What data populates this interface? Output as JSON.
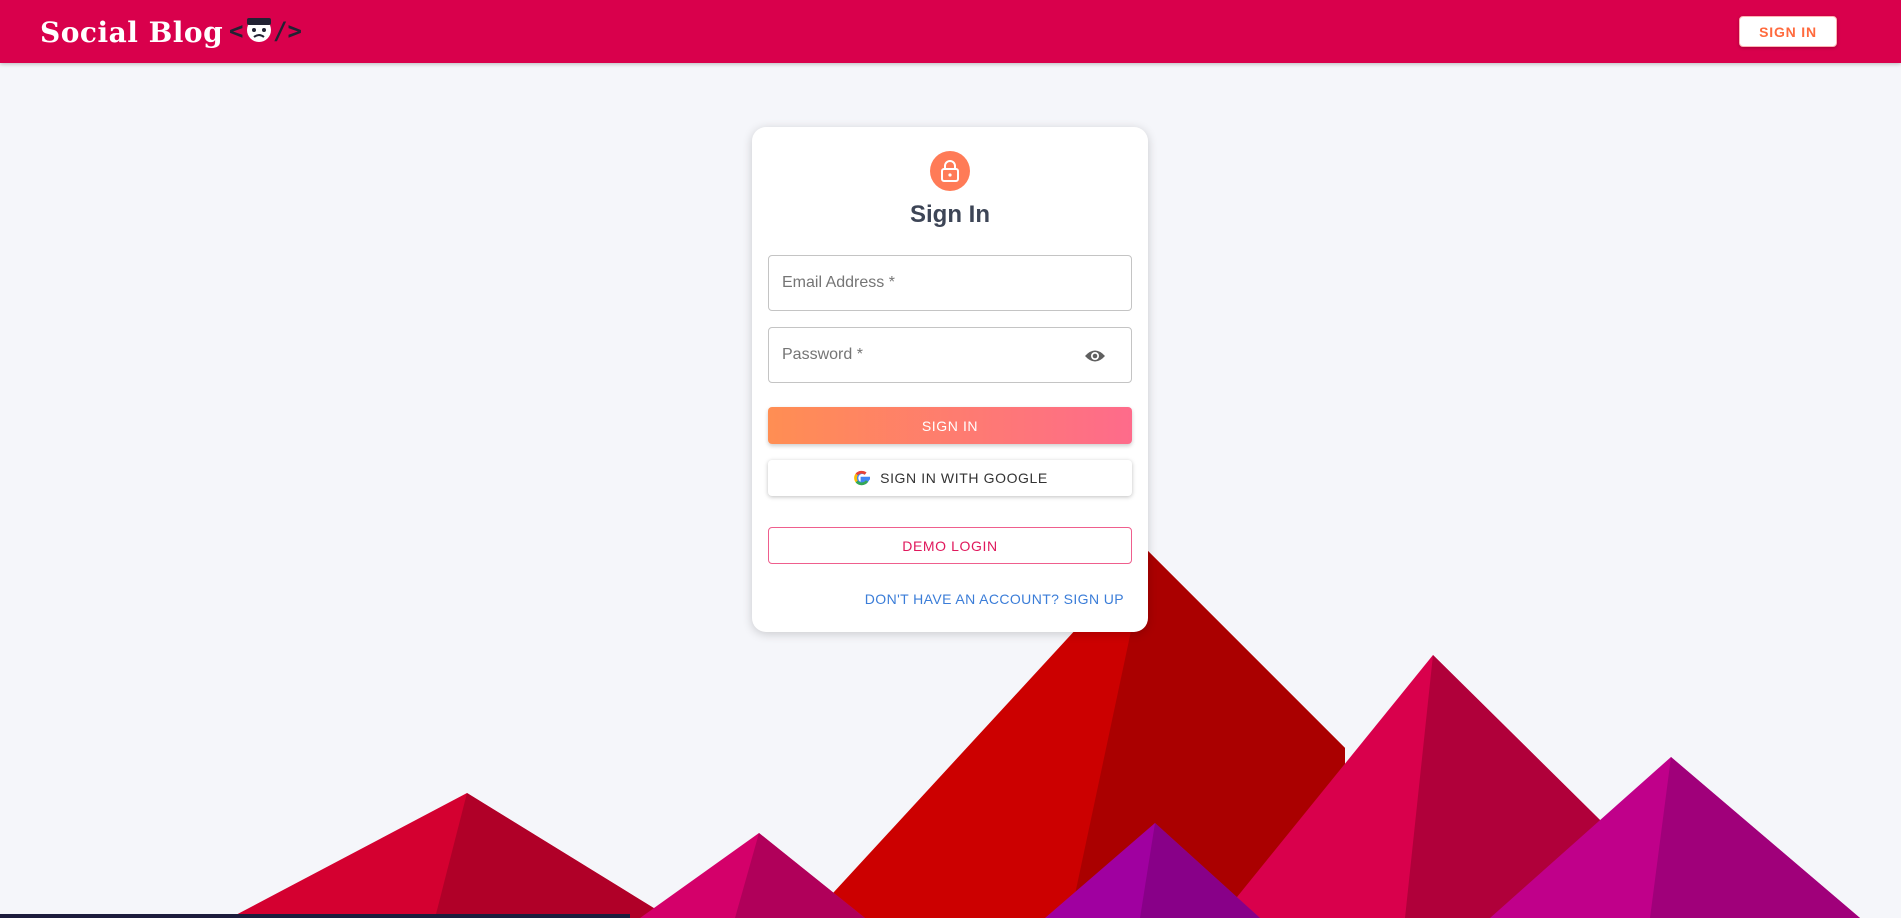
{
  "app": {
    "logo_text": "Social Blog",
    "logo_code": "</>",
    "header_signin_label": "SIGN IN"
  },
  "form": {
    "title": "Sign In",
    "email_placeholder": "Email Address *",
    "password_placeholder": "Password *",
    "signin_label": "SIGN IN",
    "google_label": "SIGN IN WITH GOOGLE",
    "demo_label": "DEMO LOGIN",
    "signup_link": "DON'T HAVE AN ACCOUNT? SIGN UP"
  },
  "icons": {
    "avatar": "lock-icon",
    "password_toggle": "eye-icon",
    "google": "google-icon"
  },
  "colors": {
    "header": "#d9004c",
    "accent": "#ff8e53",
    "accent_end": "#fe6b8b",
    "demo": "#e0185c",
    "link": "#3b7dd8",
    "background": "#f5f6fa"
  }
}
